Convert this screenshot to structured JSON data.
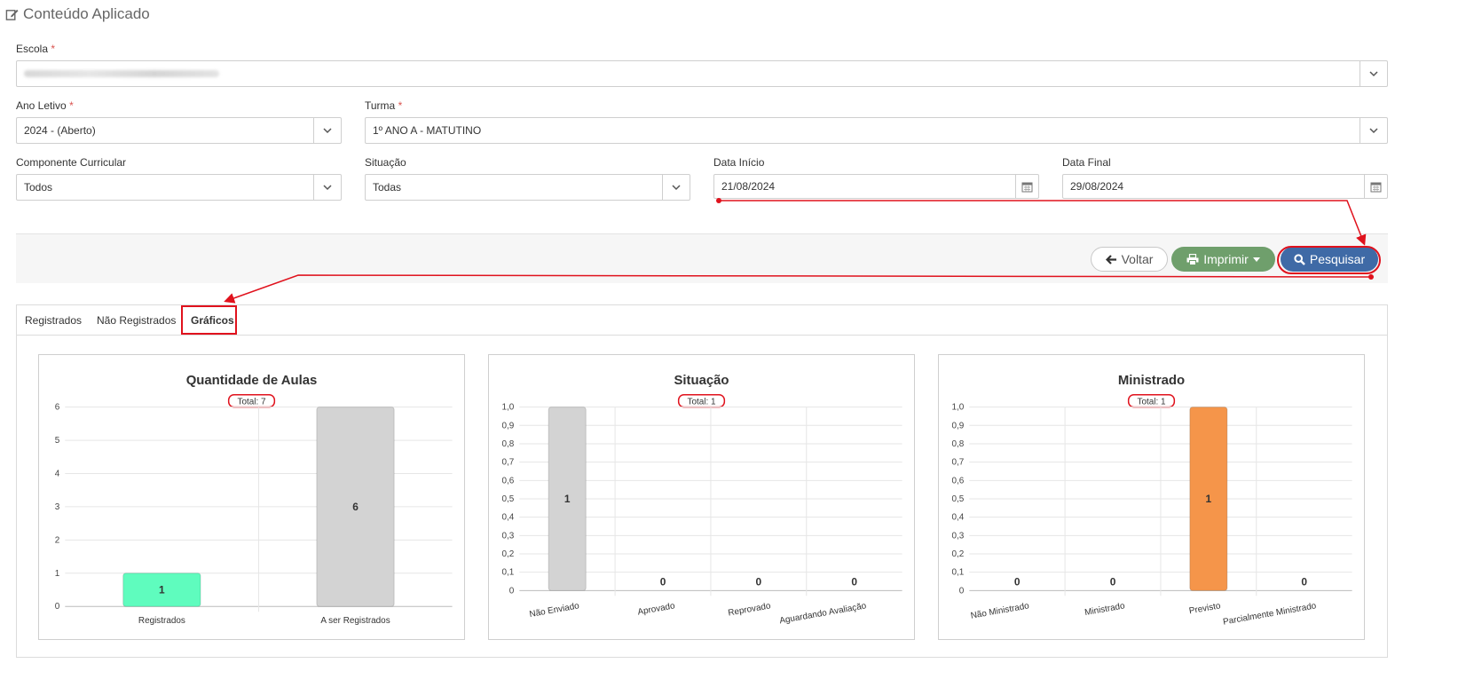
{
  "page": {
    "title": "Conteúdo Aplicado",
    "title_icon": "edit-icon"
  },
  "form": {
    "escola": {
      "label": "Escola",
      "required_mark": "*",
      "value": ""
    },
    "ano_letivo": {
      "label": "Ano Letivo",
      "required_mark": "*",
      "value": "2024 - (Aberto)"
    },
    "turma": {
      "label": "Turma",
      "required_mark": "*",
      "value": "1º ANO A - MATUTINO"
    },
    "componente": {
      "label": "Componente Curricular",
      "value": "Todos"
    },
    "situacao": {
      "label": "Situação",
      "value": "Todas"
    },
    "data_inicio": {
      "label": "Data Início",
      "value": "21/08/2024"
    },
    "data_final": {
      "label": "Data Final",
      "value": "29/08/2024"
    }
  },
  "toolbar": {
    "voltar": "Voltar",
    "imprimir": "Imprimir",
    "pesquisar": "Pesquisar"
  },
  "tabs": [
    {
      "label": "Registrados",
      "active": false
    },
    {
      "label": "Não Registrados",
      "active": false
    },
    {
      "label": "Gráficos",
      "active": true
    }
  ],
  "colors": {
    "accent": "#3f6aa6",
    "print": "#6f9f6c",
    "highlight": "#e0121d",
    "bar_green": "#5ffcbe",
    "bar_gray": "#d3d3d3",
    "bar_orange": "#f5954a"
  },
  "chart_data": [
    {
      "type": "bar",
      "title": "Quantidade de Aulas",
      "subtitle": "Total: 7",
      "categories": [
        "Registrados",
        "A ser Registrados"
      ],
      "values": [
        1,
        6
      ],
      "colors": [
        "#5ffcbe",
        "#d3d3d3"
      ],
      "ylim": [
        0,
        6
      ],
      "yticks": [
        "0",
        "1",
        "2",
        "3",
        "4",
        "5",
        "6"
      ],
      "grid": true
    },
    {
      "type": "bar",
      "title": "Situação",
      "subtitle": "Total: 1",
      "categories": [
        "Não Enviado",
        "Aprovado",
        "Reprovado",
        "Aguardando Avaliação"
      ],
      "values": [
        1,
        0,
        0,
        0
      ],
      "colors": [
        "#d3d3d3",
        "#d3d3d3",
        "#d3d3d3",
        "#d3d3d3"
      ],
      "ylim": [
        0,
        1
      ],
      "yticks": [
        "0",
        "0,1",
        "0,2",
        "0,3",
        "0,4",
        "0,5",
        "0,6",
        "0,7",
        "0,8",
        "0,9",
        "1,0"
      ],
      "grid": true
    },
    {
      "type": "bar",
      "title": "Ministrado",
      "subtitle": "Total: 1",
      "categories": [
        "Não Ministrado",
        "Ministrado",
        "Previsto",
        "Parcialmente Ministrado"
      ],
      "values": [
        0,
        0,
        1,
        0
      ],
      "colors": [
        "#f5954a",
        "#f5954a",
        "#f5954a",
        "#f5954a"
      ],
      "ylim": [
        0,
        1
      ],
      "yticks": [
        "0",
        "0,1",
        "0,2",
        "0,3",
        "0,4",
        "0,5",
        "0,6",
        "0,7",
        "0,8",
        "0,9",
        "1,0"
      ],
      "grid": true
    }
  ]
}
